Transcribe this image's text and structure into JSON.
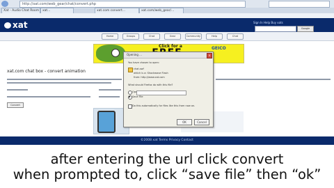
{
  "browser": {
    "address": "http://xat.com/web_gear/chat/convert.php",
    "tabs": [
      {
        "label": "Xat - Audio Chat Room"
      },
      {
        "label": "xat..."
      },
      {
        "label": "xat.com convert..."
      },
      {
        "label": "xat.com/web_gear/..."
      }
    ]
  },
  "site": {
    "logo": "xat",
    "signin": "Sign In  Help  Buy xats",
    "search_button": "Google Search",
    "nav": [
      "Home",
      "Groups",
      "Chat",
      "Gear",
      "Community",
      "Help",
      "Chat"
    ]
  },
  "ad": {
    "click_text": "Click for a",
    "free_text": "FREE",
    "brand": "GEICO"
  },
  "page": {
    "title": "xat.com chat box - convert animation",
    "convert_button": "Convert"
  },
  "dialog": {
    "title": "Opening ...",
    "intro": "You have chosen to open:",
    "file_name": "chat.swf",
    "file_type": "which is a: Shockwave Flash",
    "file_from": "from: http://www.xat.com",
    "question": "What should Firefox do with this file?",
    "open_with": "Open with",
    "save_file": "Save File",
    "auto_text": "Do this automatically for files like this from now on.",
    "ok": "OK",
    "cancel": "Cancel"
  },
  "footer": {
    "text": "©2008 xat  Terms  Privacy  Contact"
  },
  "captions": {
    "line1": "after entering the url click convert",
    "line2": "when prompted to, click “save file” then “ok”"
  }
}
